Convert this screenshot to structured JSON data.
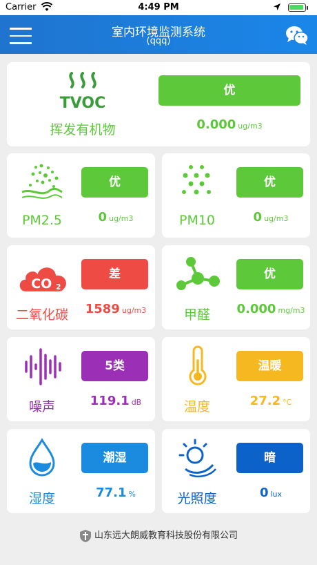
{
  "status_bar": {
    "carrier": "Carrier",
    "time": "4:49 PM"
  },
  "header": {
    "title": "室内环境监测系统",
    "subtitle": "(qqq)",
    "menu_icon": "menu-icon",
    "wechat_icon": "wechat-icon"
  },
  "tvoc": {
    "icon_text": "TVOC",
    "label": "挥发有机物",
    "status": "优",
    "value": "0.000",
    "unit": "ug/m3",
    "color": "#5dc93a"
  },
  "cards": {
    "pm25": {
      "label": "PM2.5",
      "status": "优",
      "value": "0",
      "unit": "ug/m3",
      "color": "#5dc93a"
    },
    "pm10": {
      "label": "PM10",
      "status": "优",
      "value": "0",
      "unit": "ug/m3",
      "color": "#5dc93a"
    },
    "co2": {
      "icon_text": "CO",
      "icon_sub": "2",
      "label": "二氧化碳",
      "status": "差",
      "value": "1589",
      "unit": "ug/m3",
      "color": "#ef4b45"
    },
    "formaldehyde": {
      "label": "甲醛",
      "status": "优",
      "value": "0.000",
      "unit": "mg/m3",
      "color": "#5dc93a"
    },
    "noise": {
      "label": "噪声",
      "status": "5类",
      "value": "119.1",
      "unit": "dB",
      "color": "#9b30b6"
    },
    "temperature": {
      "label": "温度",
      "status": "温暖",
      "value": "27.2",
      "unit": "°C",
      "color": "#f6b820"
    },
    "humidity": {
      "label": "湿度",
      "status": "潮湿",
      "value": "77.1",
      "unit": "%",
      "color": "#1a8bde"
    },
    "illuminance": {
      "label": "光照度",
      "status": "暗",
      "value": "0",
      "unit": "lux",
      "color": "#0c62c9"
    }
  },
  "footer": {
    "company": "山东远大朗威教育科技股份有限公司"
  }
}
